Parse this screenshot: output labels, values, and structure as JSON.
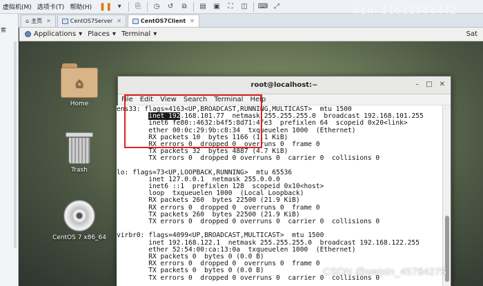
{
  "host": {
    "menu": [
      "虚拟机(M)",
      "选项卡(T)",
      "帮助(H)"
    ],
    "tabs": [
      {
        "label": "主页",
        "active": false
      },
      {
        "label": "CentOS7Server",
        "active": false
      },
      {
        "label": "CentOS7Client",
        "active": true
      }
    ],
    "left_label": "索"
  },
  "guest": {
    "topbar": {
      "applications": "Applications",
      "places": "Places",
      "terminal": "Terminal",
      "user": "Sat"
    },
    "desktop_icons": [
      {
        "label": "Home",
        "icon": "home-folder-icon"
      },
      {
        "label": "Trash",
        "icon": "trash-icon"
      },
      {
        "label": "CentOS 7 x86_64",
        "icon": "disc-icon"
      }
    ]
  },
  "terminal": {
    "title": "root@localhost:~",
    "menu": [
      "File",
      "Edit",
      "View",
      "Search",
      "Terminal",
      "Help"
    ],
    "lines": [
      "ens33: flags=4163<UP,BROADCAST,RUNNING,MULTICAST>  mtu 1500",
      "        inet 192.168.101.77  netmask 255.255.255.0  broadcast 192.168.101.255",
      "        inet6 fe80::4632:b4f5:8d71:4fe3  prefixlen 64  scopeid 0x20<link>",
      "        ether 00:0c:29:9b:c8:34  txqueuelen 1000  (Ethernet)",
      "        RX packets 10  bytes 1166 (1.1 KiB)",
      "        RX errors 0  dropped 0  overruns 0  frame 0",
      "        TX packets 32  bytes 4887 (4.7 KiB)",
      "        TX errors 0  dropped 0 overruns 0  carrier 0  collisions 0",
      "",
      "lo: flags=73<UP,LOOPBACK,RUNNING>  mtu 65536",
      "        inet 127.0.0.1  netmask 255.0.0.0",
      "        inet6 ::1  prefixlen 128  scopeid 0x10<host>",
      "        loop  txqueuelen 1000  (Local Loopback)",
      "        RX packets 260  bytes 22500 (21.9 KiB)",
      "        RX errors 0  dropped 0  overruns 0  frame 0",
      "        TX packets 260  bytes 22500 (21.9 KiB)",
      "        TX errors 0  dropped 0 overruns 0  carrier 0  collisions 0",
      "",
      "virbr0: flags=4099<UP,BROADCAST,MULTICAST>  mtu 1500",
      "        inet 192.168.122.1  netmask 255.255.255.0  broadcast 192.168.122.255",
      "        ether 52:54:00:ca:13:0a  txqueuelen 1000  (Ethernet)",
      "        RX packets 0  bytes 0 (0.0 B)",
      "        RX errors 0  dropped 0  overruns 0  frame 0",
      "        TX packets 0  bytes 0 (0.0 B)",
      "        TX errors 0  dropped 0 overruns 0  carrier 0  collisions 0"
    ]
  },
  "watermarks": {
    "top": "Win_11612960442",
    "bottom": "CSDN @weixin_45784275"
  },
  "colors": {
    "highlight_box": "#e02020",
    "pause_accent": "#e07a00"
  }
}
